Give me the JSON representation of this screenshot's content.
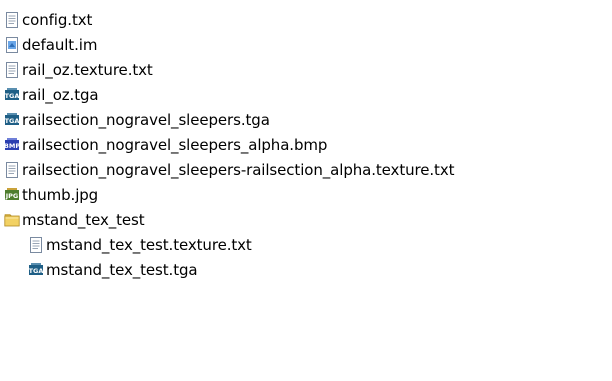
{
  "files": [
    {
      "name": "config.txt",
      "icon": "text-file-icon"
    },
    {
      "name": "default.im",
      "icon": "image-file-icon"
    },
    {
      "name": "rail_oz.texture.txt",
      "icon": "text-file-icon"
    },
    {
      "name": "rail_oz.tga",
      "icon": "tga-file-icon"
    },
    {
      "name": "railsection_nogravel_sleepers.tga",
      "icon": "tga-file-icon"
    },
    {
      "name": "railsection_nogravel_sleepers_alpha.bmp",
      "icon": "bmp-file-icon"
    },
    {
      "name": "railsection_nogravel_sleepers-railsection_alpha.texture.txt",
      "icon": "text-file-icon"
    },
    {
      "name": "thumb.jpg",
      "icon": "jpg-file-icon"
    },
    {
      "name": "mstand_tex_test",
      "icon": "folder-icon"
    },
    {
      "name": "mstand_tex_test.texture.txt",
      "icon": "text-file-icon"
    },
    {
      "name": "mstand_tex_test.tga",
      "icon": "tga-file-icon"
    }
  ],
  "icon_badges": {
    "tga": "TGA",
    "bmp": "BMP",
    "jpg": "JPG"
  },
  "colors": {
    "tga_badge": "#1f5f86",
    "bmp_badge": "#2b3fb0",
    "jpg_badge": "#4e7d2d",
    "folder": "#f2d163",
    "text_icon_border": "#7a8aa0"
  }
}
